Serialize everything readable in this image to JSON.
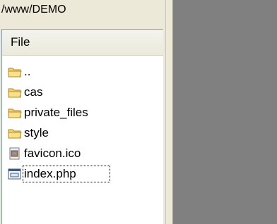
{
  "path": "/www/DEMO",
  "panel": {
    "header": "File",
    "items": [
      {
        "name": "..",
        "icon": "folder-icon"
      },
      {
        "name": "cas",
        "icon": "folder-icon"
      },
      {
        "name": "private_files",
        "icon": "folder-icon"
      },
      {
        "name": "style",
        "icon": "folder-icon"
      },
      {
        "name": "favicon.ico",
        "icon": "image-file-icon"
      },
      {
        "name": "index.php",
        "icon": "php-file-icon"
      }
    ]
  },
  "colors": {
    "pane_background": "#ece9d8",
    "folder": "#f3d266",
    "right_pane": "#808080"
  }
}
